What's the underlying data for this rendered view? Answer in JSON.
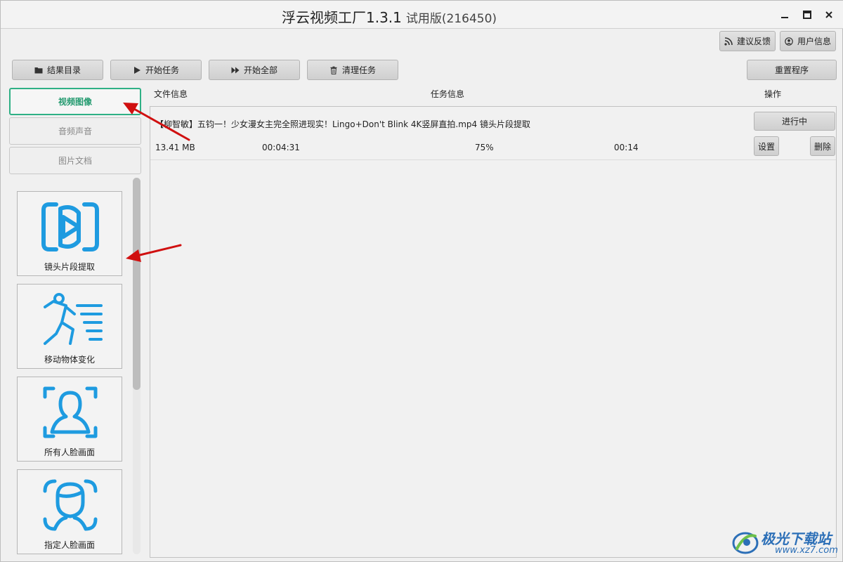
{
  "window": {
    "title": "浮云视频工厂1.3.1",
    "edition": "试用版(216450)"
  },
  "top_right": {
    "feedback_label": "建议反馈",
    "user_info_label": "用户信息"
  },
  "toolbar": {
    "result_dir_label": "结果目录",
    "start_task_label": "开始任务",
    "start_all_label": "开始全部",
    "clear_tasks_label": "清理任务",
    "reset_label": "重置程序"
  },
  "categories": [
    {
      "label": "视频图像",
      "active": true
    },
    {
      "label": "音频声音",
      "active": false
    },
    {
      "label": "图片文档",
      "active": false
    }
  ],
  "tools": [
    {
      "label": "镜头片段提取",
      "icon": "shot-clip-icon"
    },
    {
      "label": "移动物体变化",
      "icon": "running-man-icon"
    },
    {
      "label": "所有人脸画面",
      "icon": "face-scan-icon"
    },
    {
      "label": "指定人脸画面",
      "icon": "specific-face-icon"
    }
  ],
  "columns": {
    "file_info": "文件信息",
    "task_info": "任务信息",
    "actions": "操作"
  },
  "task": {
    "name": "【柳智敏】五钧一！少女漫女主完全照进现实！Lingo+Don't Blink 4K竖屏直拍.mp4 镜头片段提取",
    "size": "13.41 MB",
    "duration": "00:04:31",
    "progress": "75%",
    "elapsed": "00:14",
    "status_label": "进行中",
    "settings_label": "设置",
    "delete_label": "删除"
  },
  "watermark": {
    "name": "极光下载站",
    "url": "www.xz7.com"
  },
  "colors": {
    "accent": "#2fb085",
    "icon_blue": "#1e9be0",
    "arrow_red": "#d01010"
  }
}
